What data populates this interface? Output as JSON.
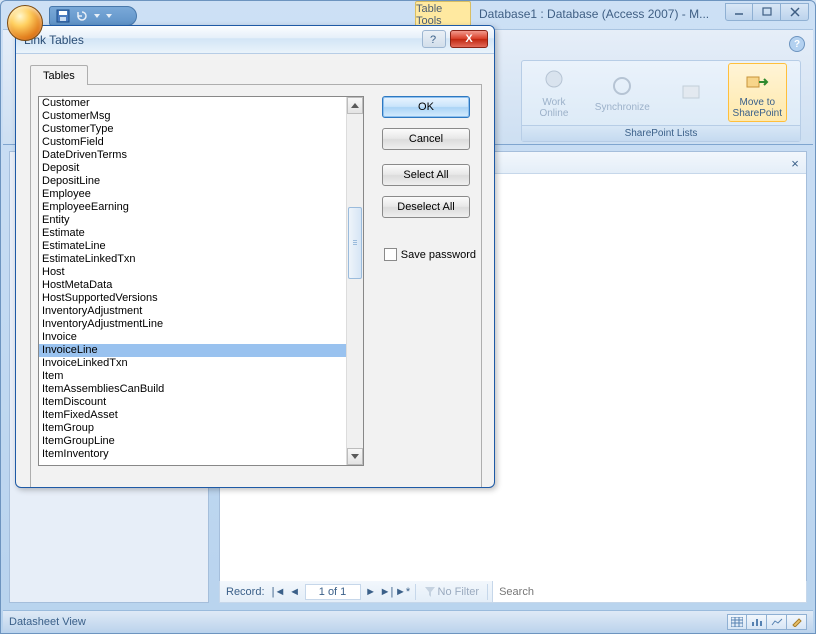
{
  "window": {
    "context_tab": "Table Tools",
    "title": "Database1 : Database (Access 2007) - M..."
  },
  "ribbon": {
    "help": "?",
    "group_label": "SharePoint Lists",
    "buttons": {
      "work_online": "Work\nOnline",
      "synchronize": "Synchronize",
      "spacer": "",
      "move_to_sp": "Move to\nSharePoint"
    }
  },
  "record_nav": {
    "label": "Record:",
    "first": "|◄",
    "prev": "◄",
    "current": "1 of 1",
    "next": "►",
    "new": "►|",
    "newrec": "►*",
    "no_filter": "No Filter",
    "search": "Search"
  },
  "status_bar": {
    "view": "Datasheet View"
  },
  "dialog": {
    "title": "Link Tables",
    "tab": "Tables",
    "ok": "OK",
    "cancel": "Cancel",
    "select_all": "Select All",
    "deselect_all": "Deselect All",
    "save_password": "Save password",
    "close": "X",
    "help": "?",
    "items": [
      "Customer",
      "CustomerMsg",
      "CustomerType",
      "CustomField",
      "DateDrivenTerms",
      "Deposit",
      "DepositLine",
      "Employee",
      "EmployeeEarning",
      "Entity",
      "Estimate",
      "EstimateLine",
      "EstimateLinkedTxn",
      "Host",
      "HostMetaData",
      "HostSupportedVersions",
      "InventoryAdjustment",
      "InventoryAdjustmentLine",
      "Invoice",
      "InvoiceLine",
      "InvoiceLinkedTxn",
      "Item",
      "ItemAssembliesCanBuild",
      "ItemDiscount",
      "ItemFixedAsset",
      "ItemGroup",
      "ItemGroupLine",
      "ItemInventory"
    ],
    "selected_index": 19
  }
}
